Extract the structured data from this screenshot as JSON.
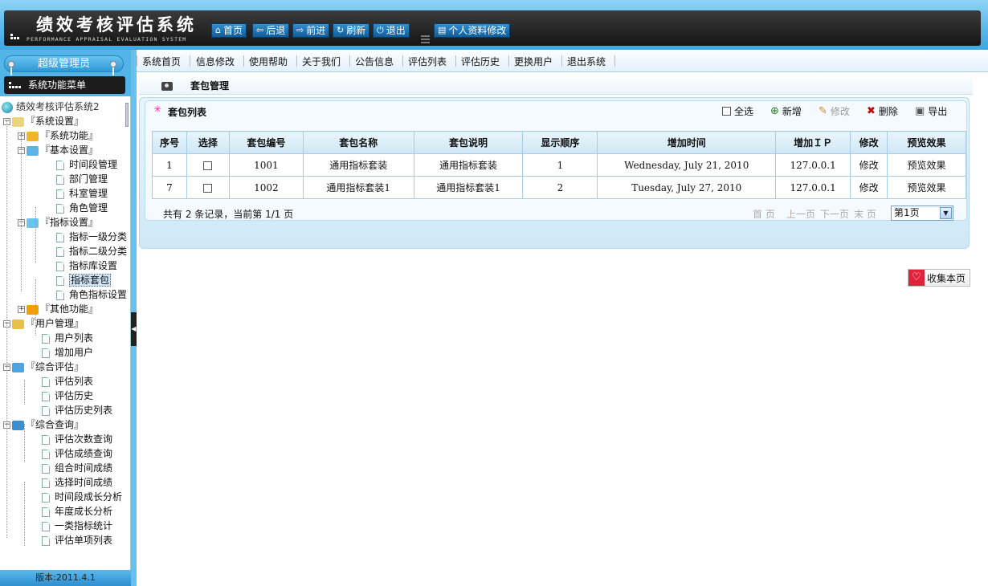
{
  "app": {
    "title": "绩效考核评估系统",
    "subtitle": "PERFORMANCE APPRAISAL EVALUATION SYSTEM"
  },
  "header_nav": [
    {
      "label": "首页",
      "icon": "home-icon"
    },
    {
      "label": "后退",
      "icon": "arrow-left-icon"
    },
    {
      "label": "前进",
      "icon": "arrow-right-icon"
    },
    {
      "label": "刷新",
      "icon": "refresh-icon"
    },
    {
      "label": "退出",
      "icon": "power-icon"
    },
    {
      "label": "个人资料修改",
      "icon": "profile-icon"
    }
  ],
  "sidebar": {
    "role": "超级管理员",
    "menu_title": "系统功能菜单",
    "root": "绩效考核评估系统2",
    "version": "版本:2011.4.1",
    "tree": [
      {
        "label": "『系统设置』",
        "expand": "−"
      },
      {
        "label": "『系统功能』",
        "expand": "+"
      },
      {
        "label": "『基本设置』",
        "expand": "−"
      },
      {
        "label": "时间段管理"
      },
      {
        "label": "部门管理"
      },
      {
        "label": "科室管理"
      },
      {
        "label": "角色管理"
      },
      {
        "label": "『指标设置』",
        "expand": "−"
      },
      {
        "label": "指标一级分类"
      },
      {
        "label": "指标二级分类"
      },
      {
        "label": "指标库设置"
      },
      {
        "label": "指标套包"
      },
      {
        "label": "角色指标设置"
      },
      {
        "label": "『其他功能』",
        "expand": "+"
      },
      {
        "label": "『用户管理』",
        "expand": "−"
      },
      {
        "label": "用户列表"
      },
      {
        "label": "增加用户"
      },
      {
        "label": "『综合评估』",
        "expand": "−"
      },
      {
        "label": "评估列表"
      },
      {
        "label": "评估历史"
      },
      {
        "label": "评估历史列表"
      },
      {
        "label": "『综合查询』",
        "expand": "−"
      },
      {
        "label": "评估次数查询"
      },
      {
        "label": "评估成绩查询"
      },
      {
        "label": "组合时间成绩"
      },
      {
        "label": "选择时间成绩"
      },
      {
        "label": "时间段成长分析"
      },
      {
        "label": "年度成长分析"
      },
      {
        "label": "一类指标统计"
      },
      {
        "label": "评估单项列表"
      }
    ]
  },
  "top_menu": [
    "系统首页",
    "信息修改",
    "使用帮助",
    "关于我们",
    "公告信息",
    "评估列表",
    "评估历史",
    "更换用户",
    "退出系统"
  ],
  "page": {
    "title": "套包管理",
    "panel_title": "套包列表",
    "actions": {
      "select_all": "全选",
      "add": "新增",
      "edit": "修改",
      "delete": "删除",
      "export": "导出"
    },
    "table": {
      "headers": [
        "序号",
        "选择",
        "套包编号",
        "套包名称",
        "套包说明",
        "显示顺序",
        "增加时间",
        "增加ＩＰ",
        "修改",
        "预览效果"
      ],
      "rows": [
        [
          "1",
          "",
          "1001",
          "通用指标套装",
          "通用指标套装",
          "1",
          "Wednesday, July 21, 2010",
          "127.0.0.1",
          "修改",
          "预览效果"
        ],
        [
          "7",
          "",
          "1002",
          "通用指标套装1",
          "通用指标套装1",
          "2",
          "Tuesday, July 27, 2010",
          "127.0.0.1",
          "修改",
          "预览效果"
        ]
      ]
    },
    "pager": {
      "info": "共有 2 条记录，当前第 1/1 页",
      "first": "首 页",
      "prev": "上一页",
      "next": "下一页",
      "last": "末 页",
      "selected_page": "第1页"
    },
    "favorite": "收集本页"
  },
  "colors": {
    "header_bg": "#57b7ea",
    "nav_button": "#1f76b5",
    "panel_bg": "#e6f4fc"
  }
}
